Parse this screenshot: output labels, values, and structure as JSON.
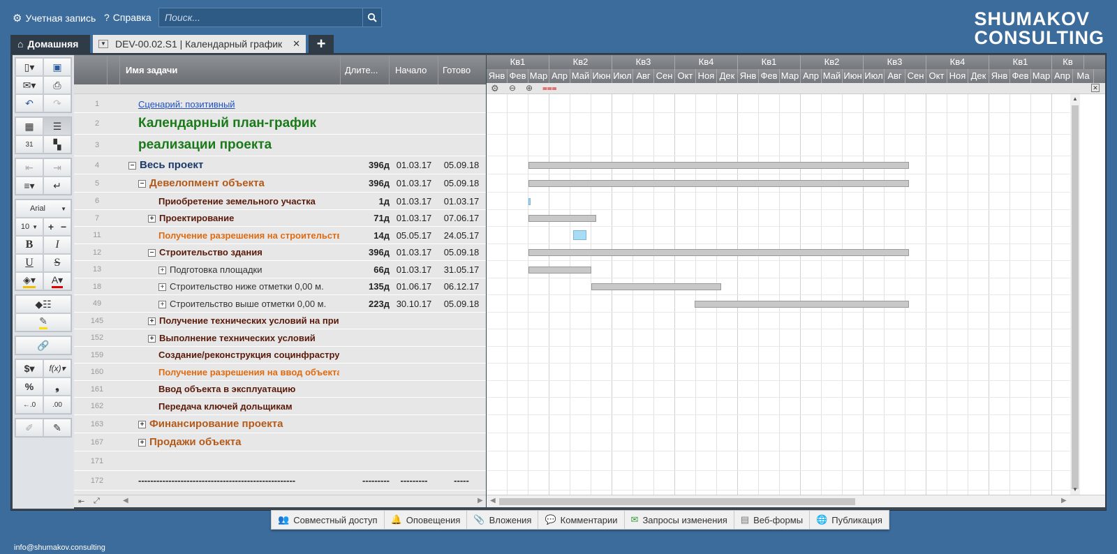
{
  "topbar": {
    "account_label": "Учетная запись",
    "help_label": "Справка",
    "search_placeholder": "Поиск..."
  },
  "logo": {
    "line1": "SHUMAKOV",
    "line2": "CONSULTING"
  },
  "tabs": {
    "home_label": "Домашняя",
    "doc_label": "DEV-00.02.S1 | Календарный график",
    "add_label": "+"
  },
  "toolbar": {
    "font_name": "Arial",
    "font_size": "10"
  },
  "grid": {
    "headers": {
      "name": "Имя задачи",
      "duration": "Длите...",
      "start": "Начало",
      "finish": "Готово"
    },
    "rows": [
      {
        "num": "1",
        "name": "Сценарий: позитивный",
        "dur": "",
        "start": "",
        "end": "",
        "style": "link"
      },
      {
        "num": "2",
        "name": "Календарный план-график",
        "dur": "",
        "start": "",
        "end": "",
        "style": "title"
      },
      {
        "num": "3",
        "name": "реализации проекта",
        "dur": "",
        "start": "",
        "end": "",
        "style": "title"
      },
      {
        "num": "4",
        "name": "Весь проект",
        "dur": "396д",
        "start": "01.03.17",
        "end": "05.09.18",
        "style": "l0"
      },
      {
        "num": "5",
        "name": "Девелопмент объекта",
        "dur": "396д",
        "start": "01.03.17",
        "end": "05.09.18",
        "style": "l1"
      },
      {
        "num": "6",
        "name": "Приобретение земельного участка",
        "dur": "1д",
        "start": "01.03.17",
        "end": "01.03.17",
        "style": "l2"
      },
      {
        "num": "7",
        "name": "Проектирование",
        "dur": "71д",
        "start": "01.03.17",
        "end": "07.06.17",
        "style": "l2"
      },
      {
        "num": "11",
        "name": "Получение разрешения на строительство",
        "dur": "14д",
        "start": "05.05.17",
        "end": "24.05.17",
        "style": "l2o"
      },
      {
        "num": "12",
        "name": "Строительство здания",
        "dur": "396д",
        "start": "01.03.17",
        "end": "05.09.18",
        "style": "l2"
      },
      {
        "num": "13",
        "name": "Подготовка площадки",
        "dur": "66д",
        "start": "01.03.17",
        "end": "31.05.17",
        "style": "l3"
      },
      {
        "num": "18",
        "name": "Строительство ниже отметки 0,00 м.",
        "dur": "135д",
        "start": "01.06.17",
        "end": "06.12.17",
        "style": "l3"
      },
      {
        "num": "49",
        "name": "Строительство выше отметки 0,00 м.",
        "dur": "223д",
        "start": "30.10.17",
        "end": "05.09.18",
        "style": "l3"
      },
      {
        "num": "145",
        "name": "Получение технических условий на присоединение",
        "dur": "",
        "start": "",
        "end": "",
        "style": "l2"
      },
      {
        "num": "152",
        "name": "Выполнение технических условий",
        "dur": "",
        "start": "",
        "end": "",
        "style": "l2"
      },
      {
        "num": "159",
        "name": "Создание/реконструкция социнфраструктуры",
        "dur": "",
        "start": "",
        "end": "",
        "style": "l2"
      },
      {
        "num": "160",
        "name": "Получение разрешения на ввод объекта",
        "dur": "",
        "start": "",
        "end": "",
        "style": "l2o"
      },
      {
        "num": "161",
        "name": "Ввод объекта в эксплуатацию",
        "dur": "",
        "start": "",
        "end": "",
        "style": "l2"
      },
      {
        "num": "162",
        "name": "Передача ключей дольщикам",
        "dur": "",
        "start": "",
        "end": "",
        "style": "l2"
      },
      {
        "num": "163",
        "name": "Финансирование проекта",
        "dur": "",
        "start": "",
        "end": "",
        "style": "l1"
      },
      {
        "num": "167",
        "name": "Продажи объекта",
        "dur": "",
        "start": "",
        "end": "",
        "style": "l1"
      },
      {
        "num": "171",
        "name": "",
        "dur": "",
        "start": "",
        "end": "",
        "style": "l2"
      },
      {
        "num": "172",
        "name": "----------------------------------------------------",
        "dur": "---------",
        "start": "---------",
        "end": "-----",
        "style": "dash"
      }
    ]
  },
  "gantt": {
    "quarters": [
      "Кв1",
      "Кв2",
      "Кв3",
      "Кв4",
      "Кв1",
      "Кв2",
      "Кв3",
      "Кв4",
      "Кв1",
      "Кв"
    ],
    "months": [
      "Янв",
      "Фев",
      "Мар",
      "Апр",
      "Май",
      "Июн",
      "Июл",
      "Авг",
      "Сен",
      "Окт",
      "Ноя",
      "Дек",
      "Янв",
      "Фев",
      "Мар",
      "Апр",
      "Май",
      "Июн",
      "Июл",
      "Авг",
      "Сен",
      "Окт",
      "Ноя",
      "Дек",
      "Янв",
      "Фев",
      "Мар",
      "Апр",
      "Ма"
    ],
    "start_month": "2017-01"
  },
  "bottom_bar": [
    "Совместный доступ",
    "Оповещения",
    "Вложения",
    "Комментарии",
    "Запросы изменения",
    "Веб-формы",
    "Публикация"
  ],
  "footer": {
    "email": "info@shumakov.consulting"
  },
  "colors": {
    "background": "#3c6c9c",
    "title_green": "#1a7a1a",
    "orange": "#e06a10",
    "dev_brown": "#b35a1a",
    "dark_red": "#5a1a0a"
  }
}
